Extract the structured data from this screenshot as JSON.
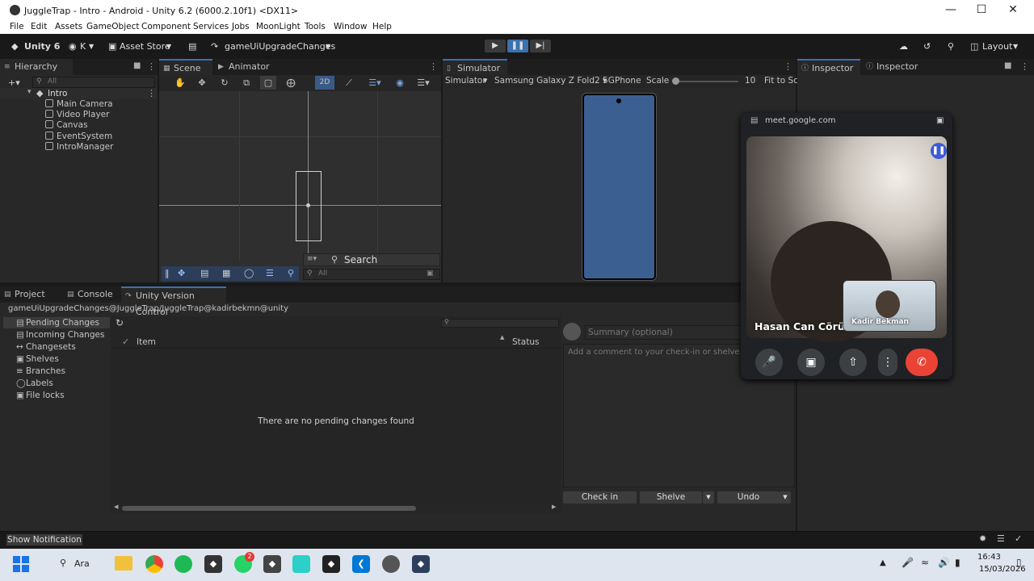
{
  "window": {
    "title": "JuggleTrap - Intro - Android - Unity 6.2 (6000.2.10f1) <DX11>"
  },
  "menu": [
    "File",
    "Edit",
    "Assets",
    "GameObject",
    "Component",
    "Services",
    "Jobs",
    "MoonLight",
    "Tools",
    "Window",
    "Help"
  ],
  "toolbar": {
    "unity_label": "Unity 6",
    "account": "K",
    "asset_store": "Asset Store",
    "branch": "gameUiUpgradeChanges",
    "layout": "Layout"
  },
  "hierarchy": {
    "tab": "Hierarchy",
    "search_placeholder": "All",
    "scene": "Intro",
    "items": [
      "Main Camera",
      "Video Player",
      "Canvas",
      "EventSystem",
      "IntroManager"
    ]
  },
  "scene": {
    "tab_scene": "Scene",
    "tab_animator": "Animator",
    "mode_2d": "2D",
    "search_label": "Search",
    "search_placeholder": "All"
  },
  "simulator": {
    "tab": "Simulator",
    "dropdown": "Simulator",
    "device": "Samsung Galaxy Z Fold2 5G",
    "phone": "Phone",
    "scale_label": "Scale",
    "scale_value": "10",
    "fit": "Fit to Sc"
  },
  "inspector": {
    "tab1": "Inspector",
    "tab2": "Inspector"
  },
  "bottom": {
    "tabs": [
      "Project",
      "Console",
      "Unity Version Control"
    ],
    "workspace_path": "gameUiUpgradeChanges@JuggleTrap/JuggleTrap@kadirbekmn@unity",
    "nav": [
      {
        "label": "Pending Changes",
        "icon": "pending-icon"
      },
      {
        "label": "Incoming Changes",
        "icon": "incoming-icon"
      },
      {
        "label": "Changesets",
        "icon": "changesets-icon"
      },
      {
        "label": "Shelves",
        "icon": "shelves-icon"
      },
      {
        "label": "Branches",
        "icon": "branches-icon"
      },
      {
        "label": "Labels",
        "icon": "labels-icon"
      },
      {
        "label": "File locks",
        "icon": "lock-icon"
      }
    ],
    "col_item": "Item",
    "col_status": "Status",
    "empty_msg": "There are no pending changes found",
    "summary_placeholder": "Summary (optional)",
    "comment_placeholder": "Add a comment to your check-in or shelve...",
    "checkin": "Check in",
    "shelve": "Shelve",
    "undo": "Undo"
  },
  "meet": {
    "url": "meet.google.com",
    "participant": "Hasan Can Cörüt",
    "self_name": "Kadir Bekman"
  },
  "status": {
    "notification": "Show Notification"
  },
  "taskbar": {
    "search": "Ara",
    "time": "16:43",
    "date": "15/03/2026",
    "whatsapp_badge": "2"
  },
  "colors": {
    "accent": "#3a72b0",
    "end_call": "#ea4335",
    "phone_screen": "#3c5f91"
  }
}
